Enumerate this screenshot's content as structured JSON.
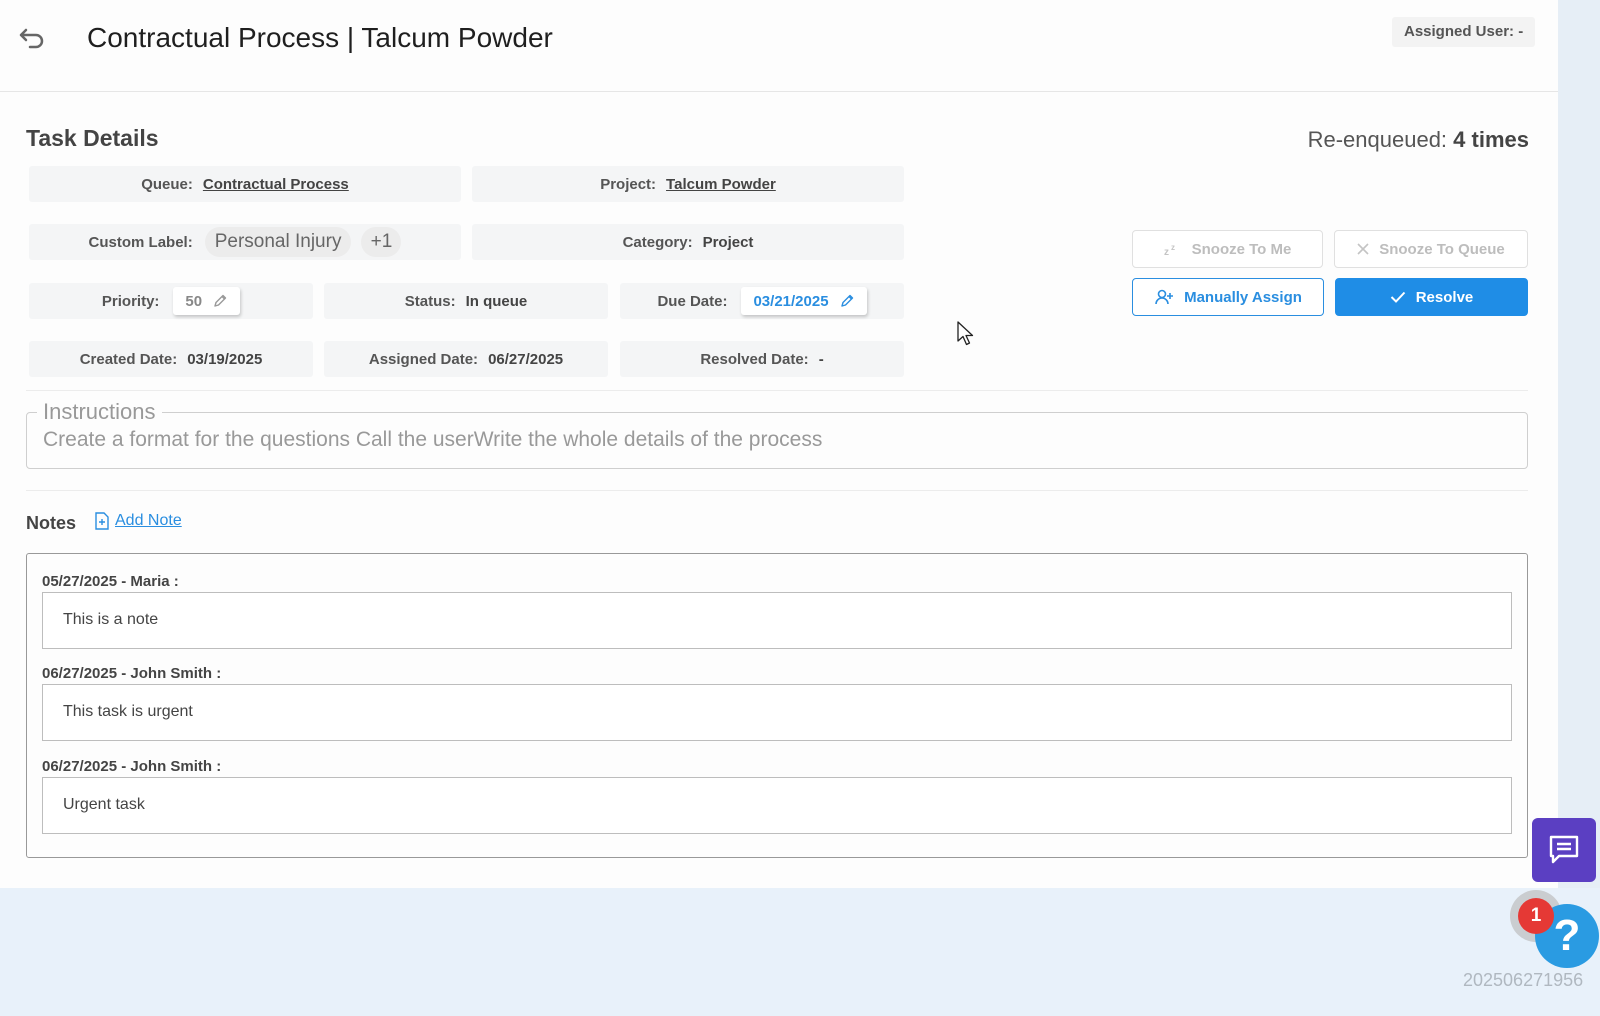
{
  "header": {
    "title": "Contractual Process | Talcum Powder",
    "assigned_user_label": "Assigned User:",
    "assigned_user_value": "-"
  },
  "task": {
    "section_title": "Task Details",
    "reenqueued_label": "Re-enqueued:",
    "reenqueued_value": "4 times",
    "queue_label": "Queue:",
    "queue_value": "Contractual Process",
    "project_label": "Project:",
    "project_value": "Talcum Powder",
    "custom_label_label": "Custom Label:",
    "custom_label_value": "Personal Injury",
    "custom_label_more": "+1",
    "category_label": "Category:",
    "category_value": "Project",
    "priority_label": "Priority:",
    "priority_value": "50",
    "status_label": "Status:",
    "status_value": "In queue",
    "due_date_label": "Due Date:",
    "due_date_value": "03/21/2025",
    "created_label": "Created Date:",
    "created_value": "03/19/2025",
    "assigned_label": "Assigned Date:",
    "assigned_value": "06/27/2025",
    "resolved_label": "Resolved Date:",
    "resolved_value": "-"
  },
  "actions": {
    "snooze_me": "Snooze To Me",
    "snooze_queue": "Snooze To Queue",
    "manually_assign": "Manually Assign",
    "resolve": "Resolve"
  },
  "instructions": {
    "legend": "Instructions",
    "text": "Create a format for the questions Call the userWrite the whole details of the process"
  },
  "notes": {
    "label": "Notes",
    "add_label": "Add Note",
    "items": [
      {
        "header": "05/27/2025 - Maria :",
        "body": "This is a note"
      },
      {
        "header": "06/27/2025 - John Smith :",
        "body": "This task is urgent"
      },
      {
        "header": "06/27/2025 - John Smith :",
        "body": "Urgent task"
      }
    ]
  },
  "widgets": {
    "help_symbol": "?",
    "notification_count": "1",
    "build_number": "202506271956"
  },
  "colors": {
    "accent": "#1f8de6",
    "chat": "#5b3fc2",
    "badge": "#e53935"
  }
}
